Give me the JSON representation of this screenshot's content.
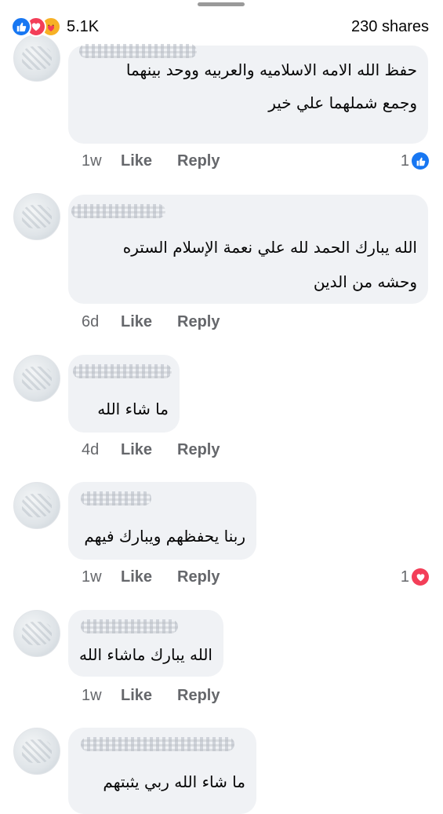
{
  "header": {
    "reaction_icons": [
      "like-icon",
      "love-icon",
      "care-icon"
    ],
    "reaction_count": "5.1K",
    "shares_label": "230 shares"
  },
  "comments": [
    {
      "author_partial": "عـ",
      "lines": [
        "حفظ الله الامه الاسلاميه والعربيه ووحد بينهما",
        "وجمع شملهما علي خير"
      ],
      "time": "1w",
      "like_label": "Like",
      "reply_label": "Reply",
      "reaction_count": "1",
      "reaction_icon": "like-icon"
    },
    {
      "lines": [
        "الله يبارك  الحمد لله علي نعمة الإسلام الستره",
        "وحشه من الدين"
      ],
      "time": "6d",
      "like_label": "Like",
      "reply_label": "Reply"
    },
    {
      "lines": [
        "ما شاء الله"
      ],
      "time": "4d",
      "like_label": "Like",
      "reply_label": "Reply"
    },
    {
      "lines": [
        "ربنا يحفظهم ويبارك فيهم"
      ],
      "time": "1w",
      "like_label": "Like",
      "reply_label": "Reply",
      "reaction_count": "1",
      "reaction_icon": "love-icon"
    },
    {
      "lines": [
        "الله يبارك ماشاء الله"
      ],
      "time": "1w",
      "like_label": "Like",
      "reply_label": "Reply"
    },
    {
      "lines": [
        "ما شاء الله ربي يثبتهم"
      ]
    }
  ],
  "colors": {
    "like_blue": "#1877f2",
    "love_red": "#f33e58",
    "care_yellow": "#f7b125",
    "bubble_bg": "#f0f2f5",
    "meta_gray": "#65676b"
  }
}
